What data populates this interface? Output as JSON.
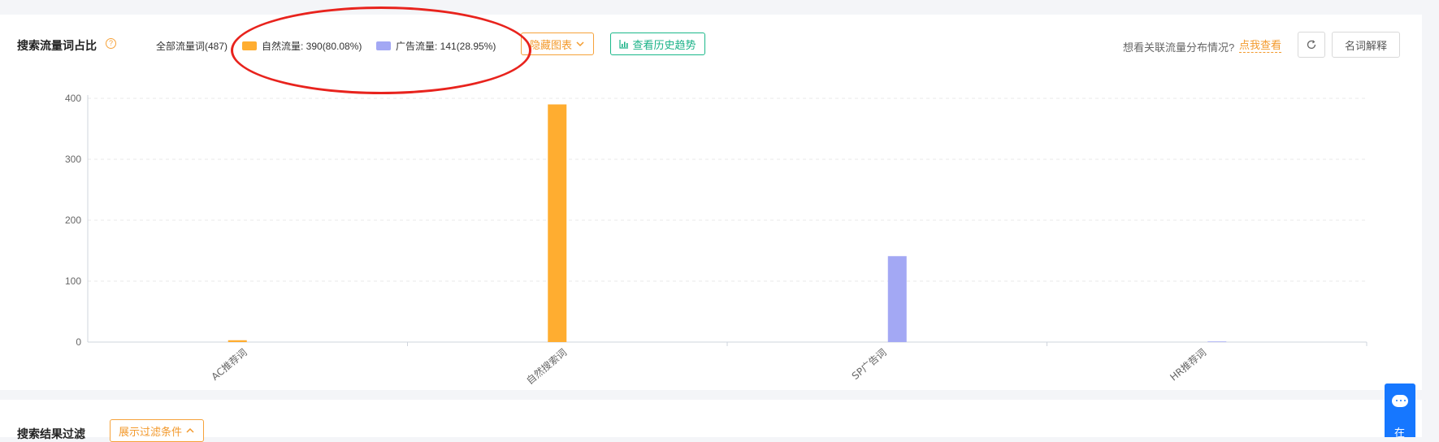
{
  "header": {
    "title": "搜索流量词占比",
    "help_icon": "question-circle-icon",
    "total_label": "全部流量词(487)",
    "legend": [
      {
        "label": "自然流量: 390(80.08%)",
        "color": "#ffad30"
      },
      {
        "label": "广告流量: 141(28.95%)",
        "color": "#a3a8f4"
      }
    ],
    "hide_chart_label": "隐藏图表",
    "history_label": "查看历史趋势",
    "hint_text": "想看关联流量分布情况?",
    "hint_link": "点我查看",
    "names_label": "名词解释"
  },
  "chart_data": {
    "type": "bar",
    "categories": [
      "AC推荐词",
      "自然搜索词",
      "SP广告词",
      "HR推荐词"
    ],
    "series": [
      {
        "name": "自然流量",
        "color": "#ffad30",
        "values": [
          3,
          390,
          0,
          0
        ]
      },
      {
        "name": "广告流量",
        "color": "#a3a8f4",
        "values": [
          0,
          0,
          141,
          1
        ]
      }
    ],
    "ylim": [
      0,
      400
    ],
    "yticks": [
      0,
      100,
      200,
      300,
      400
    ],
    "grid": true,
    "legend_position": "top-left"
  },
  "filter_section": {
    "title": "搜索结果过滤",
    "toggle_label": "展示过滤条件"
  },
  "chat_widget": {
    "label": "在"
  }
}
